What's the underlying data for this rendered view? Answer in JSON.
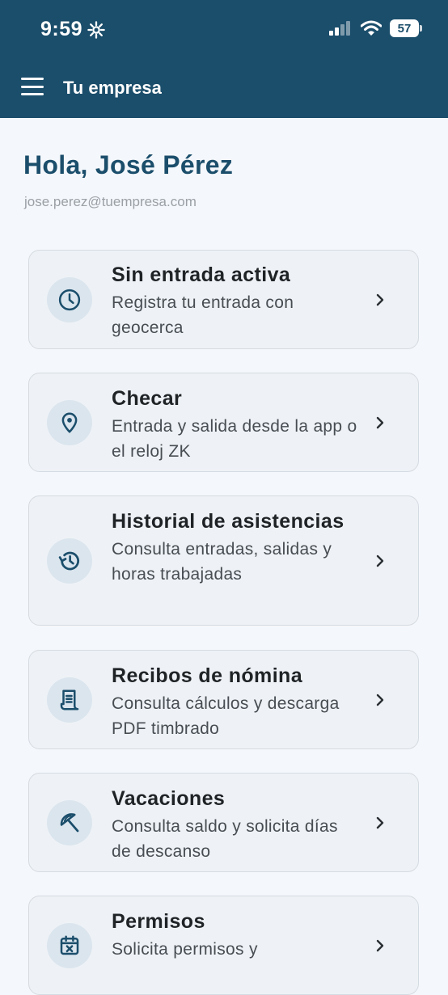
{
  "status_bar": {
    "time": "9:59",
    "battery": "57"
  },
  "header": {
    "title": "Tu empresa"
  },
  "greeting": "Hola, José Pérez",
  "email": "jose.perez@tuempresa.com",
  "cards": [
    {
      "title": "Sin entrada activa",
      "subtitle": "Registra tu entrada con geocerca",
      "icon": "clock-icon"
    },
    {
      "title": "Checar",
      "subtitle": "Entrada y salida desde la app o el reloj ZK",
      "icon": "location-pin-icon"
    },
    {
      "title": "Historial de asistencias",
      "subtitle": "Consulta entradas, salidas y horas trabajadas",
      "icon": "history-icon"
    },
    {
      "title": "Recibos de nómina",
      "subtitle": "Consulta cálculos y descarga PDF timbrado",
      "icon": "receipt-icon"
    },
    {
      "title": "Vacaciones",
      "subtitle": "Consulta saldo y solicita días de descanso",
      "icon": "beach-umbrella-icon"
    },
    {
      "title": "Permisos",
      "subtitle": "Solicita permisos y",
      "icon": "calendar-x-icon"
    }
  ],
  "colors": {
    "header_bg": "#1b4e6b",
    "page_bg": "#f4f7fb",
    "card_bg": "#eef2f6",
    "icon_bg": "#dbe5ee",
    "accent": "#1b4e6b"
  }
}
